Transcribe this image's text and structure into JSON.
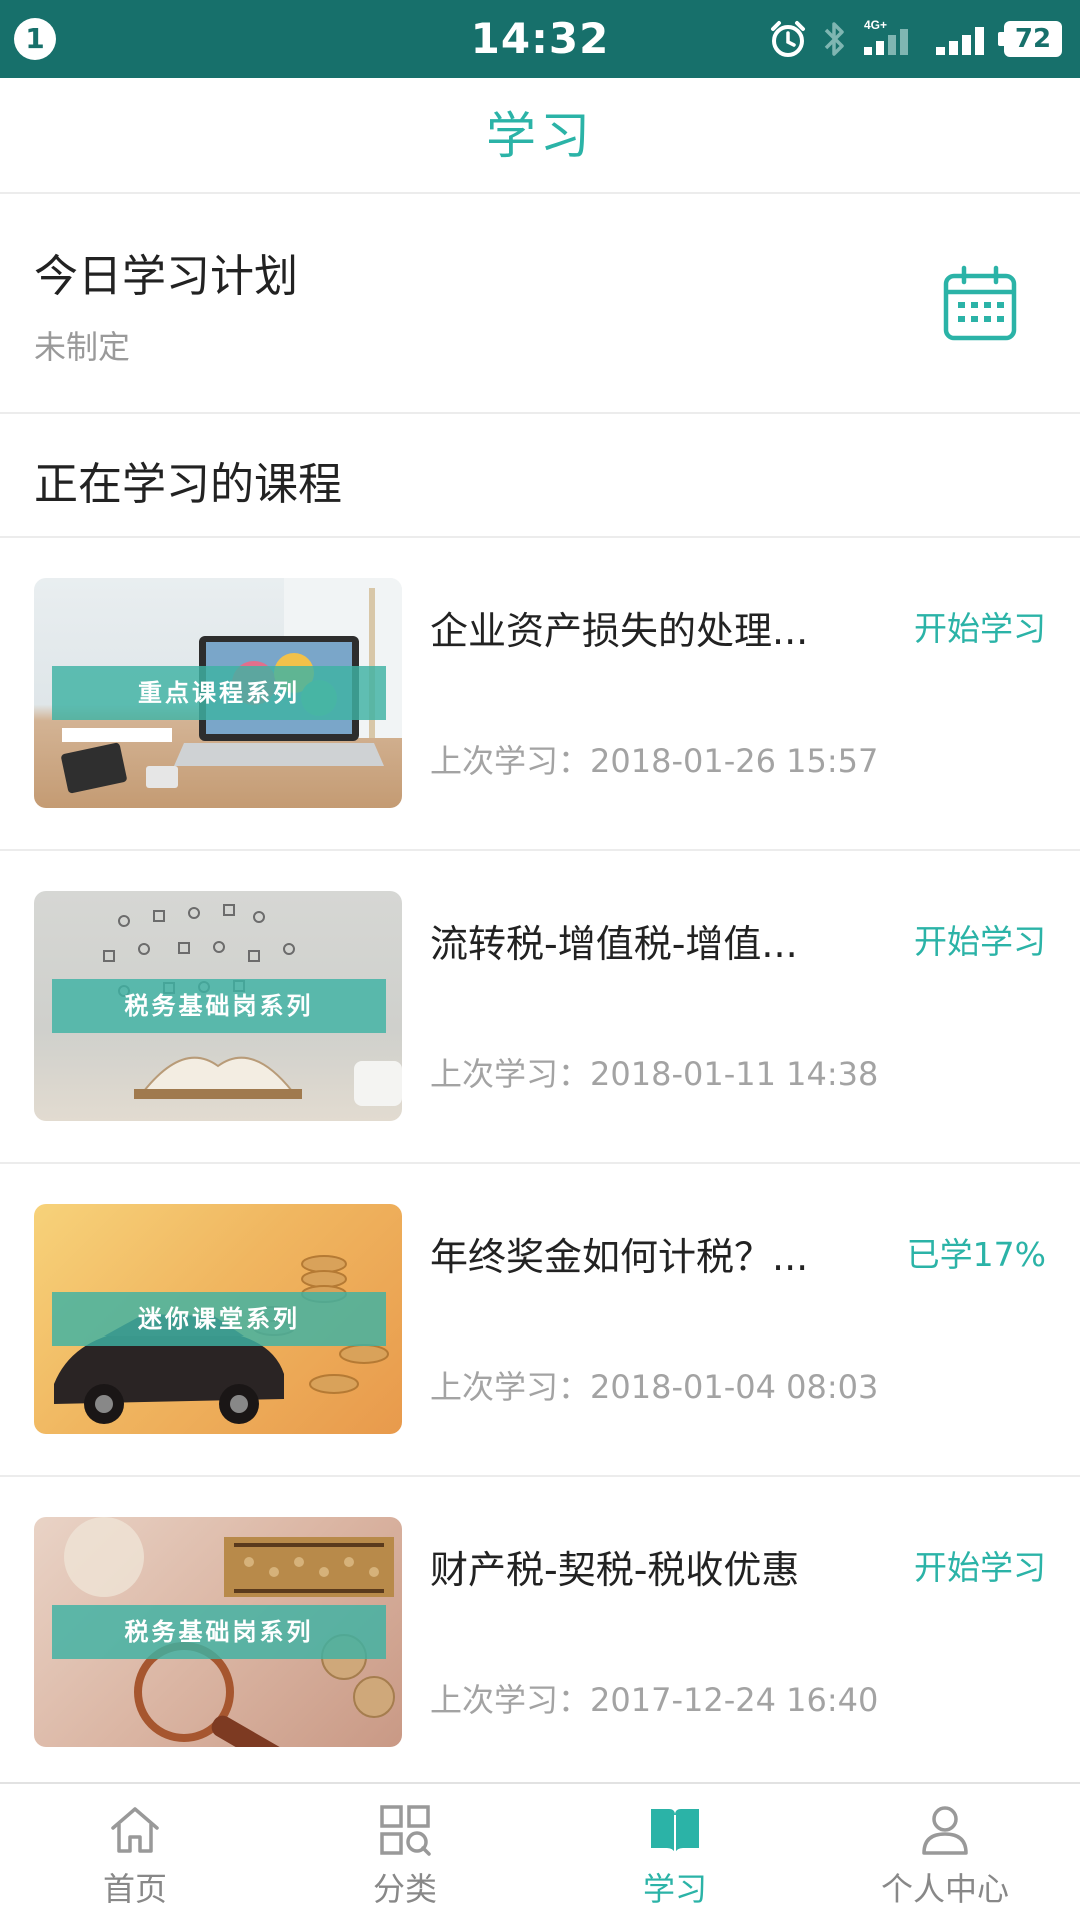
{
  "status_bar": {
    "notification_count": "1",
    "time": "14:32",
    "network": "4G+",
    "battery": "72",
    "icons": [
      "alarm-icon",
      "bluetooth-icon",
      "signal-4g-icon",
      "signal-icon",
      "battery-icon"
    ]
  },
  "header": {
    "title": "学习"
  },
  "plan": {
    "title": "今日学习计划",
    "status": "未制定",
    "icon": "calendar-icon"
  },
  "section": {
    "title": "正在学习的课程"
  },
  "courses": [
    {
      "title": "企业资产损失的处理...",
      "action": "开始学习",
      "last_study": "上次学习：2018-01-26 15:57",
      "thumb_label": "重点课程系列"
    },
    {
      "title": "流转税-增值税-增值...",
      "action": "开始学习",
      "last_study": "上次学习：2018-01-11 14:38",
      "thumb_label": "税务基础岗系列"
    },
    {
      "title": "年终奖金如何计税？...",
      "action": "已学17%",
      "last_study": "上次学习：2018-01-04 08:03",
      "thumb_label": "迷你课堂系列"
    },
    {
      "title": "财产税-契税-税收优惠",
      "action": "开始学习",
      "last_study": "上次学习：2017-12-24 16:40",
      "thumb_label": "税务基础岗系列"
    }
  ],
  "bottom_nav": {
    "items": [
      {
        "label": "首页",
        "icon": "home-icon",
        "active": false
      },
      {
        "label": "分类",
        "icon": "category-icon",
        "active": false
      },
      {
        "label": "学习",
        "icon": "book-icon",
        "active": true
      },
      {
        "label": "个人中心",
        "icon": "user-icon",
        "active": false
      }
    ]
  },
  "colors": {
    "status_bar": "#17706b",
    "accent": "#2bb3a7",
    "divider": "#ececec",
    "muted_text": "#a3a3a3"
  }
}
